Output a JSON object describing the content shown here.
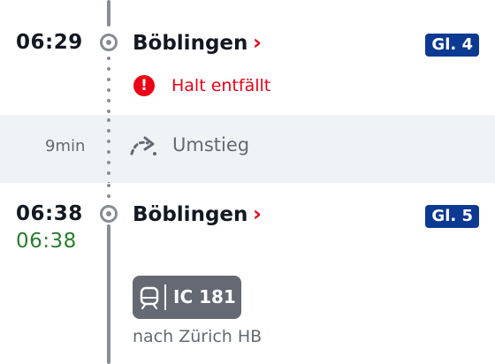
{
  "stop1": {
    "time": "06:29",
    "station": "Böblingen",
    "chevron": "›",
    "track": "Gl. 4"
  },
  "alert": {
    "icon": "exclamation-icon",
    "icon_glyph": "!",
    "text": "Halt entfällt",
    "color": "#ec0016"
  },
  "transfer": {
    "duration": "9min",
    "icon": "transfer-arrow-icon",
    "label": "Umstieg"
  },
  "stop2": {
    "time": "06:38",
    "realtime": "06:38",
    "station": "Böblingen",
    "chevron": "›",
    "track": "Gl. 5"
  },
  "train": {
    "icon": "train-icon",
    "name": "IC 181",
    "direction": "nach Zürich HB"
  },
  "colors": {
    "track_badge": "#0c3992",
    "realtime": "#2a7d2e",
    "timeline": "#878c96",
    "chip": "#646973"
  }
}
